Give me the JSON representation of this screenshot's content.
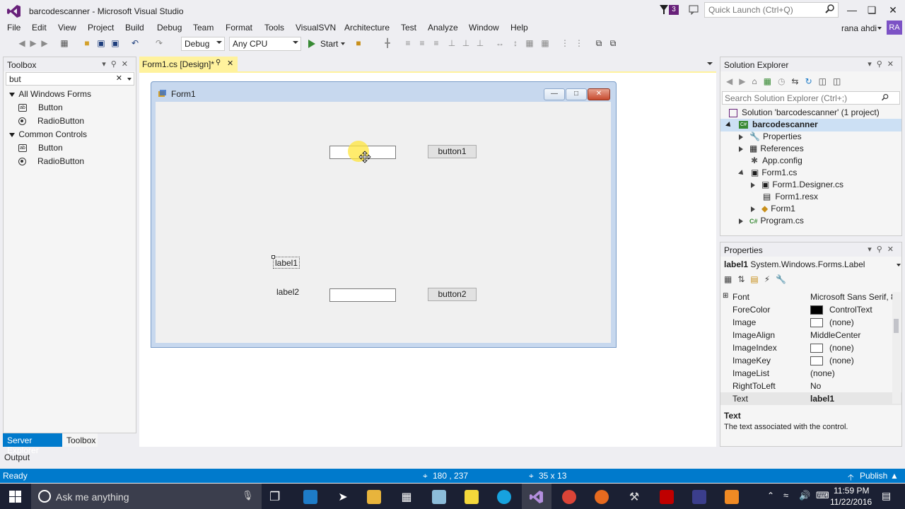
{
  "window": {
    "title": "barcodescanner - Microsoft Visual Studio",
    "notifications": "3",
    "quick_launch_placeholder": "Quick Launch (Ctrl+Q)"
  },
  "menu": [
    "File",
    "Edit",
    "View",
    "Project",
    "Build",
    "Debug",
    "Team",
    "Format",
    "Tools",
    "VisualSVN",
    "Architecture",
    "Test",
    "Analyze",
    "Window",
    "Help"
  ],
  "user": {
    "name": "rana ahdi",
    "initials": "RA"
  },
  "toolbar": {
    "config": "Debug",
    "platform": "Any CPU",
    "start": "Start"
  },
  "toolbox": {
    "title": "Toolbox",
    "search": "but",
    "groups": [
      {
        "name": "All Windows Forms",
        "items": [
          "Button",
          "RadioButton"
        ]
      },
      {
        "name": "Common Controls",
        "items": [
          "Button",
          "RadioButton"
        ]
      }
    ],
    "tabs": [
      "Server Explorer",
      "Toolbox"
    ]
  },
  "document": {
    "tab": "Form1.cs [Design]*"
  },
  "form": {
    "title": "Form1",
    "button1": "button1",
    "button2": "button2",
    "label1": "label1",
    "label2": "label2"
  },
  "solution_explorer": {
    "title": "Solution Explorer",
    "search_placeholder": "Search Solution Explorer (Ctrl+;)",
    "items": [
      "Solution 'barcodescanner' (1 project)",
      "barcodescanner",
      "Properties",
      "References",
      "App.config",
      "Form1.cs",
      "Form1.Designer.cs",
      "Form1.resx",
      "Form1",
      "Program.cs"
    ]
  },
  "properties": {
    "title": "Properties",
    "object": "label1",
    "type": "System.Windows.Forms.Label",
    "rows": [
      {
        "name": "Font",
        "value": "Microsoft Sans Serif, 8."
      },
      {
        "name": "ForeColor",
        "value": "ControlText"
      },
      {
        "name": "Image",
        "value": "(none)"
      },
      {
        "name": "ImageAlign",
        "value": "MiddleCenter"
      },
      {
        "name": "ImageIndex",
        "value": "(none)"
      },
      {
        "name": "ImageKey",
        "value": "(none)"
      },
      {
        "name": "ImageList",
        "value": "(none)"
      },
      {
        "name": "RightToLeft",
        "value": "No"
      },
      {
        "name": "Text",
        "value": "label1"
      }
    ],
    "desc_title": "Text",
    "desc": "The text associated with the control."
  },
  "output": "Output",
  "status": {
    "left": "Ready",
    "position": "180 , 237",
    "size": "35 x 13",
    "publish": "Publish"
  },
  "taskbar": {
    "search": "Ask me anything",
    "time": "11:59 PM",
    "date": "11/22/2016"
  },
  "colors": {
    "accent": "#007acc",
    "active_tab": "#fff29d",
    "taskbar": "#1b2033"
  }
}
